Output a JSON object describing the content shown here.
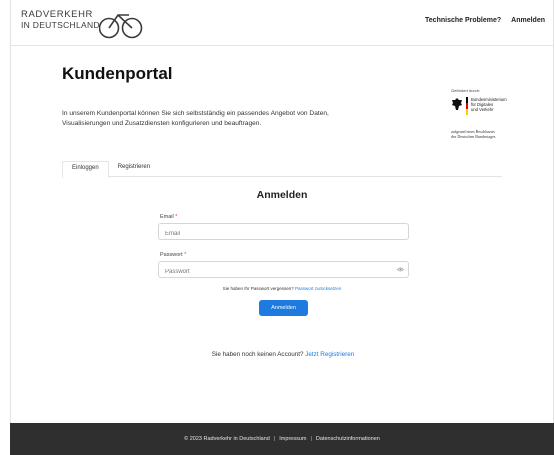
{
  "header": {
    "logo_line1": "RADVERKEHR",
    "logo_line2": "IN DEUTSCHLAND",
    "links": [
      "Technische Probleme?",
      "Anmelden"
    ]
  },
  "page": {
    "title": "Kundenportal",
    "intro": "In unserem Kundenportal können Sie sich selbstständig ein passendes Angebot von Daten, Visualisierungen und Zusatzdiensten konfigurieren und beauftragen."
  },
  "ministry": {
    "gefoerdert": "Gefördert durch:",
    "name_lines": [
      "Bundesministerium",
      "für Digitales",
      "und Verkehr"
    ],
    "beschluss_lines": [
      "aufgrund eines Beschlusses",
      "des Deutschen Bundestages"
    ]
  },
  "tabs": [
    "Einloggen",
    "Registrieren"
  ],
  "form": {
    "title": "Anmelden",
    "email_label": "Email",
    "email_placeholder": "Email",
    "password_label": "Passwort",
    "password_placeholder": "Passwort",
    "required_mark": "*",
    "forgot_text": "Sie haben Ihr Passwort vergessen?",
    "forgot_link": "Passwort zurücksetzen",
    "submit_label": "Anmelden",
    "account_text": "Sie haben noch keinen Account?",
    "account_link": "Jetzt Registrieren"
  },
  "footer": {
    "copyright": "© 2023 Radverkehr in Deutschland",
    "separator": "|",
    "impressum": "Impressum",
    "datenschutz": "Datenschutzinformationen"
  },
  "colors": {
    "accent": "#1f7ae0",
    "footer_bg": "#2f2f2f",
    "required": "#e0483b"
  },
  "icons": [
    "bicycle-icon",
    "federal-eagle-icon",
    "eye-icon"
  ]
}
